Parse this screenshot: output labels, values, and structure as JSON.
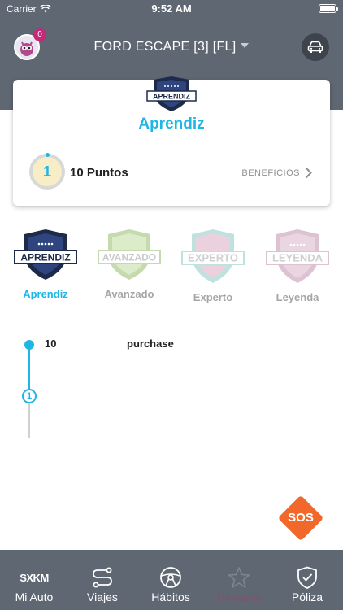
{
  "status_bar": {
    "carrier": "Carrier",
    "time": "9:52 AM"
  },
  "header": {
    "avatar_badge": "0",
    "vehicle_title": "FORD ESCAPE [3] [FL]"
  },
  "level_card": {
    "badge_text": "APRENDIZ",
    "level_name": "Aprendiz",
    "points_value": "1",
    "points_label": "10 Puntos",
    "benefits_label": "BENEFICIOS"
  },
  "tiers": [
    {
      "badge_text": "APRENDIZ",
      "label": "Aprendiz",
      "color": "#1e2a4a",
      "active": true
    },
    {
      "badge_text": "AVANZADO",
      "label": "Avanzado",
      "color": "#b6cf9a",
      "active": false
    },
    {
      "badge_text": "EXPERTO",
      "label": "Experto",
      "color": "#a9d4d0",
      "active": false
    },
    {
      "badge_text": "LEYENDA",
      "label": "Leyenda",
      "color": "#c9a6bb",
      "active": false
    }
  ],
  "timeline": {
    "points": "10",
    "description": "purchase",
    "marker": "1"
  },
  "sos_label": "SOS",
  "tabbar": {
    "items": [
      {
        "label": "Mi Auto",
        "icon": "sxkm-logo-icon",
        "logo_text": "SXKM"
      },
      {
        "label": "Viajes",
        "icon": "route-icon"
      },
      {
        "label": "Hábitos",
        "icon": "steering-wheel-icon"
      },
      {
        "label": "Rewards",
        "icon": "star-icon"
      },
      {
        "label": "Póliza",
        "icon": "shield-check-icon"
      }
    ]
  },
  "colors": {
    "header": "#5f6772",
    "accent": "#1fb6e6",
    "sos": "#f2682a",
    "badge": "#c4297a"
  }
}
